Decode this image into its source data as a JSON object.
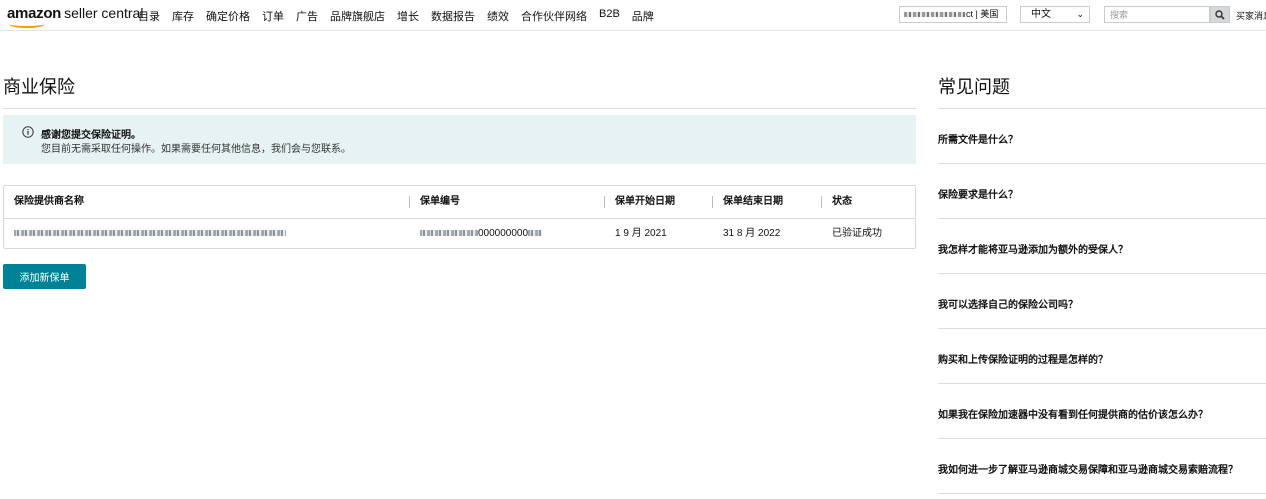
{
  "header": {
    "logo_brand": "amazon",
    "logo_product": "seller central",
    "nav": [
      "目录",
      "库存",
      "确定价格",
      "订单",
      "广告",
      "品牌旗舰店",
      "增长",
      "数据报告",
      "绩效",
      "合作伙伴网络",
      "B2B",
      "品牌"
    ],
    "account_suffix": "ct | 美国",
    "language": "中文",
    "search_placeholder": "搜索",
    "buyer_messages": "买家消息"
  },
  "main": {
    "title": "商业保险",
    "alert": {
      "title": "感谢您提交保险证明。",
      "body": "您目前无需采取任何操作。如果需要任何其他信息，我们会与您联系。"
    },
    "table": {
      "headers": [
        "保险提供商名称",
        "保单编号",
        "保单开始日期",
        "保单结束日期",
        "状态"
      ],
      "rows": [
        {
          "policy_number_visible": "000000000",
          "start_date": "1 9 月 2021",
          "end_date": "31 8 月 2022",
          "status": "已验证成功"
        }
      ]
    },
    "add_button": "添加新保单"
  },
  "faq": {
    "title": "常见问题",
    "items": [
      "所需文件是什么？",
      "保险要求是什么？",
      "我怎样才能将亚马逊添加为额外的受保人？",
      "我可以选择自己的保险公司吗？",
      "购买和上传保险证明的过程是怎样的？",
      "如果我在保险加速器中没有看到任何提供商的估价该怎么办？",
      "我如何进一步了解亚马逊商城交易保障和亚马逊商城交易索赔流程？"
    ]
  },
  "colors": {
    "accent": "#008296",
    "alert_bg": "#e6f2f3",
    "logo_smile": "#ff9900"
  }
}
